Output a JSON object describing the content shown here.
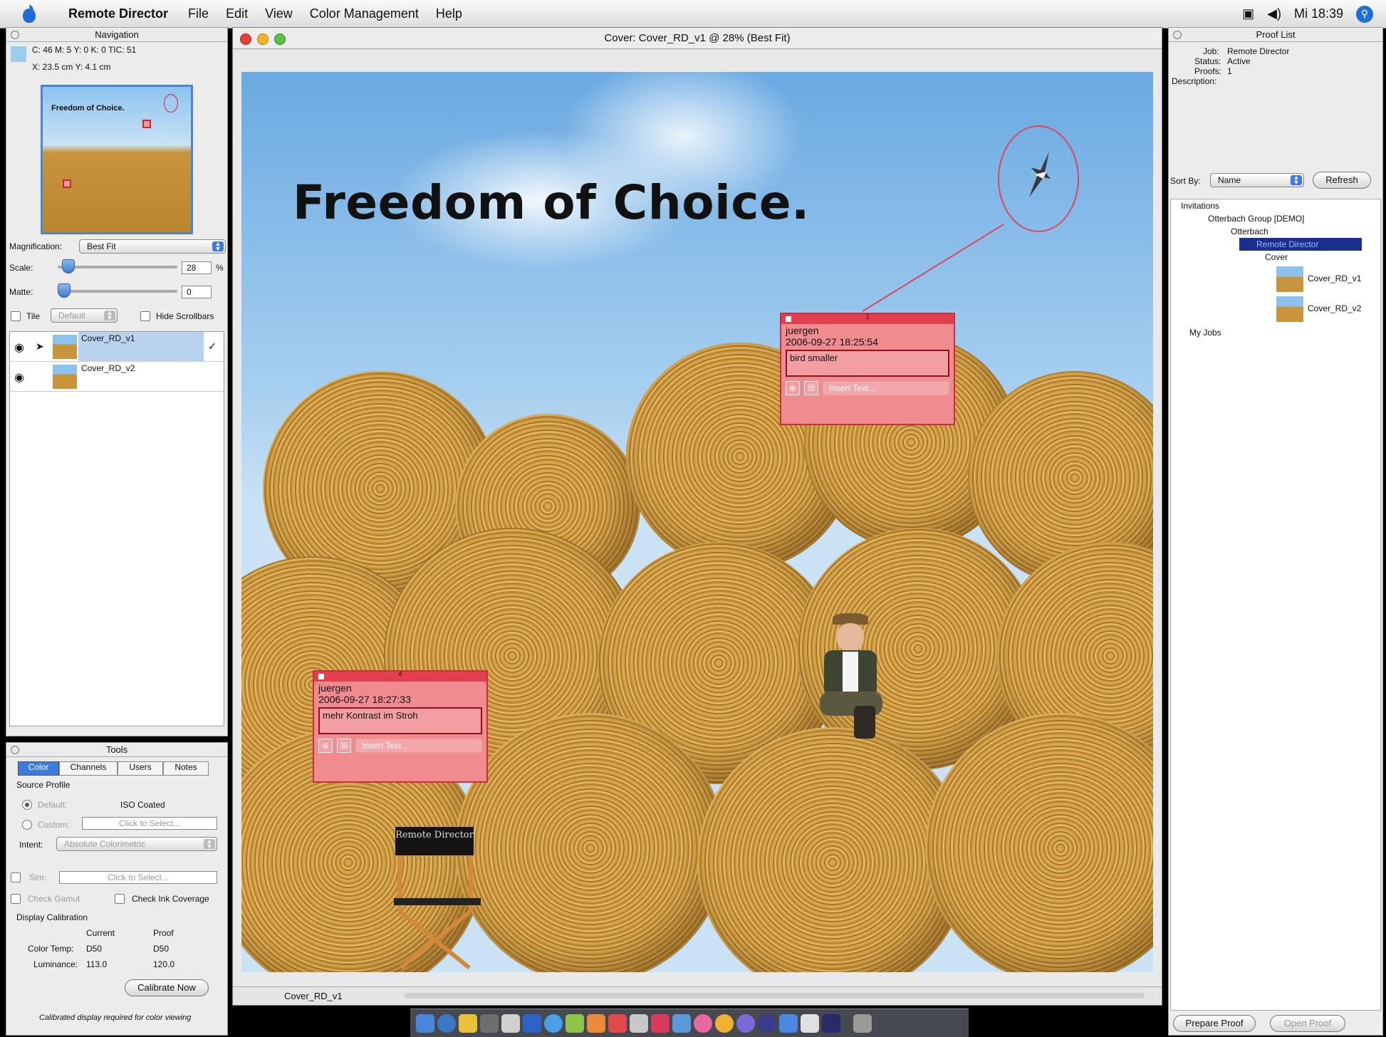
{
  "menubar": {
    "app_name": "Remote Director",
    "menus": [
      "File",
      "Edit",
      "View",
      "Color Management",
      "Help"
    ],
    "clock": "Mi 18:39"
  },
  "navigation": {
    "title": "Navigation",
    "color_readout": "C: 46 M: 5 Y: 0 K: 0   TIC: 51",
    "position_readout": "X: 23.5 cm   Y: 4.1 cm",
    "thumb_text": "Freedom of Choice.",
    "magnification_label": "Magnification:",
    "magnification_value": "Best Fit",
    "scale_label": "Scale:",
    "scale_value": "28",
    "scale_unit": "%",
    "matte_label": "Matte:",
    "matte_value": "0",
    "tile_label": "Tile",
    "tile_value": "Default",
    "hide_scrollbars_label": "Hide Scrollbars",
    "proofs": [
      {
        "name": "Cover_RD_v1"
      },
      {
        "name": "Cover_RD_v2"
      }
    ]
  },
  "tools": {
    "title": "Tools",
    "tabs": [
      "Color",
      "Channels",
      "Users",
      "Notes"
    ],
    "source_profile_label": "Source Profile",
    "default_label": "Default:",
    "default_value": "ISO Coated",
    "custom_label": "Custom:",
    "click_to_select": "Click to Select...",
    "intent_label": "Intent:",
    "intent_value": "Absolute Colorimetric",
    "sim_label": "Sim:",
    "check_gamut_label": "Check Gamut",
    "check_ink_label": "Check Ink Coverage",
    "display_calibration_label": "Display Calibration",
    "current_header": "Current",
    "proof_header": "Proof",
    "color_temp_label": "Color Temp:",
    "color_temp_current": "D50",
    "color_temp_proof": "D50",
    "luminance_label": "Luminance:",
    "luminance_current": "113.0",
    "luminance_proof": "120.0",
    "calibrate_button": "Calibrate Now",
    "footer_note": "Calibrated display required for color viewing"
  },
  "document": {
    "title": "Cover: Cover_RD_v1 @ 28% (Best Fit)",
    "headline": "Freedom of Choice.",
    "chair_text": "Remote Director",
    "footer_name": "Cover_RD_v1",
    "notes": [
      {
        "num": "1",
        "user": "juergen",
        "timestamp": "2006-09-27 18:25:54",
        "text": "bird smaller",
        "insert": "Insert Text..."
      },
      {
        "num": "4",
        "user": "juergen",
        "timestamp": "2006-09-27 18:27:33",
        "text": "mehr Kontrast im Stroh",
        "insert": "Insert Text..."
      }
    ]
  },
  "proof_list": {
    "title": "Proof List",
    "job_label": "Job:",
    "job_value": "Remote Director",
    "status_label": "Status:",
    "status_value": "Active",
    "proofs_label": "Proofs:",
    "proofs_value": "1",
    "description_label": "Description:",
    "sort_by_label": "Sort By:",
    "sort_by_value": "Name",
    "refresh_button": "Refresh",
    "tree": {
      "invitations": "Invitations",
      "group": "Otterbach Group [DEMO]",
      "user": "Otterbach",
      "job": "Remote Director",
      "folder": "Cover",
      "items": [
        "Cover_RD_v1",
        "Cover_RD_v2"
      ],
      "my_jobs": "My Jobs"
    },
    "prepare_button": "Prepare Proof",
    "open_button": "Open Proof"
  },
  "colors": {
    "note_fill": "#f08b8f",
    "note_border": "#c8303f",
    "selection": "#1c2f8f",
    "accent": "#3d7be0"
  }
}
